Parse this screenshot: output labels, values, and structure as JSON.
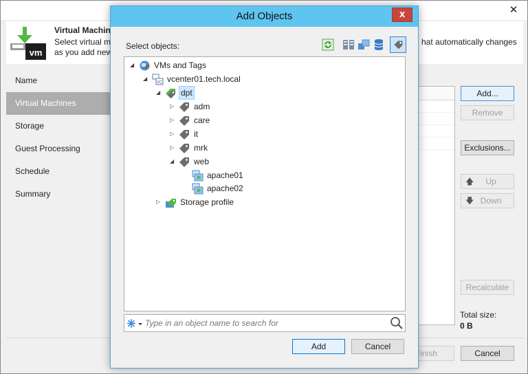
{
  "wizard": {
    "header": {
      "title": "Virtual Machine",
      "desc_line1": "Select virtual m",
      "desc_line2": "as you add new",
      "desc_right": "hat automatically changes"
    },
    "nav": [
      {
        "label": "Name"
      },
      {
        "label": "Virtual Machines",
        "active": true
      },
      {
        "label": "Storage"
      },
      {
        "label": "Guest Processing"
      },
      {
        "label": "Schedule"
      },
      {
        "label": "Summary"
      }
    ],
    "buttons": {
      "add": "Add...",
      "remove": "Remove",
      "exclusions": "Exclusions...",
      "up": "Up",
      "down": "Down",
      "recalculate": "Recalculate",
      "finish": "Finish",
      "cancel": "Cancel"
    },
    "total_size_label": "Total size:",
    "total_size_value": "0 B"
  },
  "dialog": {
    "title": "Add Objects",
    "close_glyph": "x",
    "select_label": "Select objects:",
    "tree": [
      {
        "label": "VMs and Tags",
        "icon": "vms-and-tags-icon",
        "expander": "expanded"
      },
      {
        "label": "vcenter01.tech.local",
        "icon": "vcenter-icon",
        "expander": "expanded"
      },
      {
        "label": "dpt",
        "icon": "tag-category-icon",
        "expander": "expanded",
        "selected": true
      },
      {
        "label": "adm",
        "icon": "tag-icon",
        "expander": "collapsed"
      },
      {
        "label": "care",
        "icon": "tag-icon",
        "expander": "collapsed"
      },
      {
        "label": "it",
        "icon": "tag-icon",
        "expander": "collapsed"
      },
      {
        "label": "mrk",
        "icon": "tag-icon",
        "expander": "collapsed"
      },
      {
        "label": "web",
        "icon": "tag-icon",
        "expander": "expanded"
      },
      {
        "label": "apache01",
        "icon": "vm-icon",
        "expander": "none"
      },
      {
        "label": "apache02",
        "icon": "vm-icon",
        "expander": "none"
      },
      {
        "label": "Storage profile",
        "icon": "storage-profile-icon",
        "expander": "collapsed"
      }
    ],
    "search_placeholder": "Type in an object name to search for",
    "add_button": "Add",
    "cancel_button": "Cancel"
  },
  "colors": {
    "dialog_titlebar": "#5ec4f0",
    "close_button": "#c7463a",
    "selection": "#cce8ff",
    "nav_active": "#adadad",
    "tag_gray": "#6d6d6d",
    "vm_green": "#52b845"
  }
}
